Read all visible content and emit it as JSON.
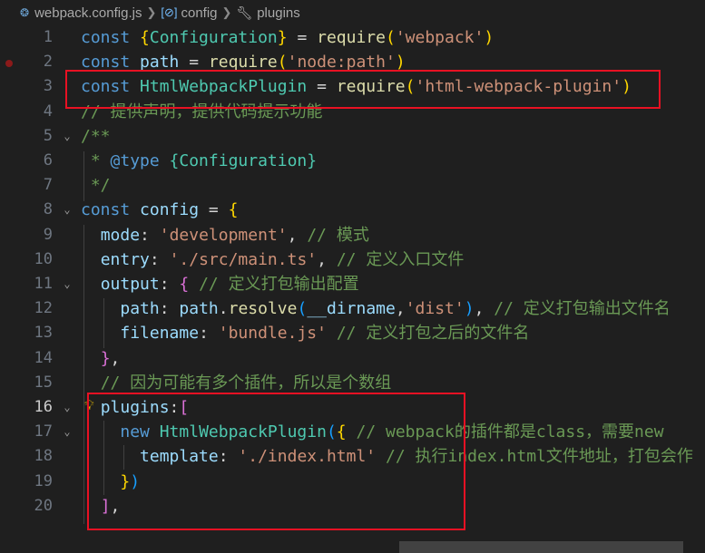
{
  "breadcrumb": {
    "file_icon": "webpack-file-icon",
    "file": "webpack.config.js",
    "var_icon": "variable-icon",
    "var": "config",
    "prop_icon": "wrench-icon",
    "prop": "plugins"
  },
  "lines": [
    {
      "num": "1",
      "tokens": [
        [
          "k",
          "const "
        ],
        [
          "b1",
          "{"
        ],
        [
          "t",
          "Configuration"
        ],
        [
          "b1",
          "}"
        ],
        [
          "p",
          " = "
        ],
        [
          "f",
          "require"
        ],
        [
          "b1",
          "("
        ],
        [
          "s",
          "'webpack'"
        ],
        [
          "b1",
          ")"
        ]
      ]
    },
    {
      "num": "2",
      "tokens": [
        [
          "k",
          "const "
        ],
        [
          "v",
          "path"
        ],
        [
          "p",
          " = "
        ],
        [
          "f",
          "require"
        ],
        [
          "b1",
          "("
        ],
        [
          "s",
          "'node:path'"
        ],
        [
          "b1",
          ")"
        ]
      ]
    },
    {
      "num": "3",
      "tokens": [
        [
          "k",
          "const "
        ],
        [
          "t",
          "HtmlWebpackPlugin"
        ],
        [
          "p",
          " = "
        ],
        [
          "f",
          "require"
        ],
        [
          "b1",
          "("
        ],
        [
          "s",
          "'html-webpack-plugin'"
        ],
        [
          "b1",
          ")"
        ]
      ]
    },
    {
      "num": "4",
      "tokens": [
        [
          "c",
          "// 提供声明，提供代码提示功能"
        ]
      ]
    },
    {
      "num": "5",
      "tokens": [
        [
          "c",
          "/**"
        ]
      ]
    },
    {
      "num": "6",
      "tokens": [
        [
          "c",
          " * "
        ],
        [
          "ck",
          "@type"
        ],
        [
          "c",
          " "
        ],
        [
          "ct",
          "{Configuration}"
        ]
      ]
    },
    {
      "num": "7",
      "tokens": [
        [
          "c",
          " */"
        ]
      ]
    },
    {
      "num": "8",
      "tokens": [
        [
          "k",
          "const "
        ],
        [
          "v",
          "config"
        ],
        [
          "p",
          " = "
        ],
        [
          "b1",
          "{"
        ]
      ]
    },
    {
      "num": "9",
      "tokens": [
        [
          "p",
          "  "
        ],
        [
          "v",
          "mode"
        ],
        [
          "p",
          ": "
        ],
        [
          "s",
          "'development'"
        ],
        [
          "p",
          ", "
        ],
        [
          "c",
          "// 模式"
        ]
      ]
    },
    {
      "num": "10",
      "tokens": [
        [
          "p",
          "  "
        ],
        [
          "v",
          "entry"
        ],
        [
          "p",
          ": "
        ],
        [
          "s",
          "'./src/main.ts'"
        ],
        [
          "p",
          ", "
        ],
        [
          "c",
          "// 定义入口文件"
        ]
      ]
    },
    {
      "num": "11",
      "tokens": [
        [
          "p",
          "  "
        ],
        [
          "v",
          "output"
        ],
        [
          "p",
          ": "
        ],
        [
          "b2",
          "{"
        ],
        [
          "p",
          " "
        ],
        [
          "c",
          "// 定义打包输出配置"
        ]
      ]
    },
    {
      "num": "12",
      "tokens": [
        [
          "p",
          "    "
        ],
        [
          "v",
          "path"
        ],
        [
          "p",
          ": "
        ],
        [
          "v",
          "path"
        ],
        [
          "p",
          "."
        ],
        [
          "f",
          "resolve"
        ],
        [
          "b3",
          "("
        ],
        [
          "v",
          "__dirname"
        ],
        [
          "p",
          ","
        ],
        [
          "s",
          "'dist'"
        ],
        [
          "b3",
          ")"
        ],
        [
          "p",
          ", "
        ],
        [
          "c",
          "// 定义打包输出文件名"
        ]
      ]
    },
    {
      "num": "13",
      "tokens": [
        [
          "p",
          "    "
        ],
        [
          "v",
          "filename"
        ],
        [
          "p",
          ": "
        ],
        [
          "s",
          "'bundle.js'"
        ],
        [
          "p",
          " "
        ],
        [
          "c",
          "// 定义打包之后的文件名"
        ]
      ]
    },
    {
      "num": "14",
      "tokens": [
        [
          "p",
          "  "
        ],
        [
          "b2",
          "}"
        ],
        [
          "p",
          ","
        ]
      ]
    },
    {
      "num": "15",
      "tokens": [
        [
          "p",
          "  "
        ],
        [
          "c",
          "// 因为可能有多个插件，所以是个数组"
        ]
      ]
    },
    {
      "num": "16",
      "tokens": [
        [
          "p",
          "  "
        ],
        [
          "v",
          "plugins"
        ],
        [
          "p",
          ":"
        ],
        [
          "b2",
          "["
        ]
      ]
    },
    {
      "num": "17",
      "tokens": [
        [
          "p",
          "    "
        ],
        [
          "k",
          "new "
        ],
        [
          "t",
          "HtmlWebpackPlugin"
        ],
        [
          "b3",
          "("
        ],
        [
          "b1",
          "{"
        ],
        [
          "p",
          " "
        ],
        [
          "c",
          "// webpack的插件都是class，需要new"
        ]
      ]
    },
    {
      "num": "18",
      "tokens": [
        [
          "p",
          "      "
        ],
        [
          "v",
          "template"
        ],
        [
          "p",
          ": "
        ],
        [
          "s",
          "'./index.html'"
        ],
        [
          "p",
          " "
        ],
        [
          "c",
          "// 执行index.html文件地址，打包会作"
        ]
      ]
    },
    {
      "num": "19",
      "tokens": [
        [
          "p",
          "    "
        ],
        [
          "b1",
          "}"
        ],
        [
          "b3",
          ")"
        ]
      ]
    },
    {
      "num": "20",
      "tokens": [
        [
          "p",
          "  "
        ],
        [
          "b2",
          "]"
        ],
        [
          "p",
          ","
        ]
      ]
    }
  ],
  "active_line": "16",
  "colors": {
    "highlight_box": "#e81123",
    "background": "#1f1f1f"
  }
}
